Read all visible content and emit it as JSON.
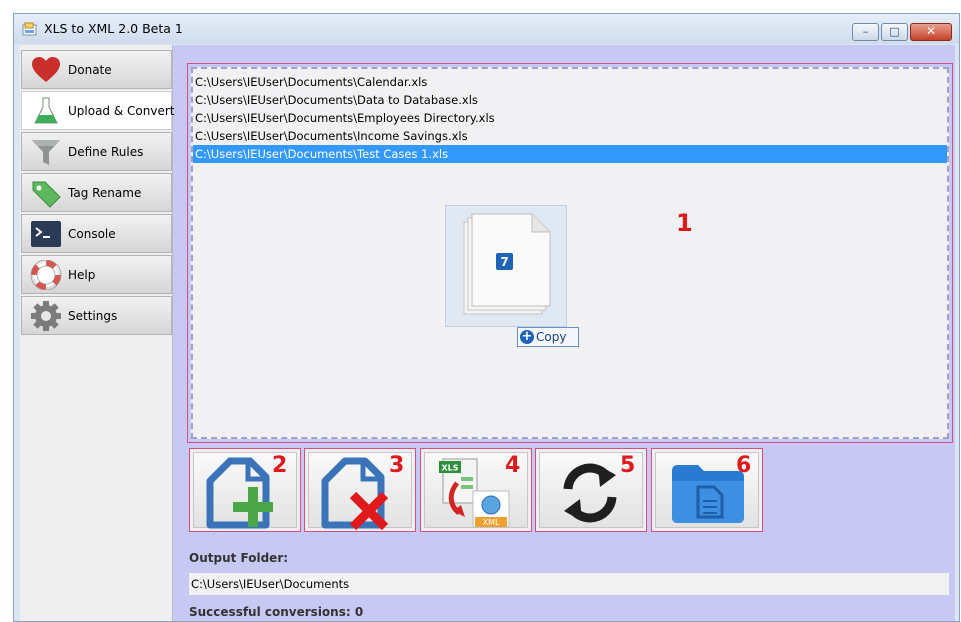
{
  "window": {
    "title": "XLS to XML 2.0 Beta 1",
    "controls": {
      "minimize": "–",
      "maximize": "□",
      "close": "✕"
    }
  },
  "sidebar": {
    "items": [
      {
        "label": "Donate",
        "icon": "heart-icon",
        "active": false
      },
      {
        "label": "Upload & Convert",
        "icon": "flask-icon",
        "active": true
      },
      {
        "label": "Define Rules",
        "icon": "funnel-icon",
        "active": false
      },
      {
        "label": "Tag Rename",
        "icon": "tag-icon",
        "active": false
      },
      {
        "label": "Console",
        "icon": "terminal-icon",
        "active": false
      },
      {
        "label": "Help",
        "icon": "lifebuoy-icon",
        "active": false
      },
      {
        "label": "Settings",
        "icon": "gear-icon",
        "active": false
      }
    ]
  },
  "files": [
    "C:\\Users\\IEUser\\Documents\\Calendar.xls",
    "C:\\Users\\IEUser\\Documents\\Data to Database.xls",
    "C:\\Users\\IEUser\\Documents\\Employees Directory.xls",
    "C:\\Users\\IEUser\\Documents\\Income Savings.xls",
    "C:\\Users\\IEUser\\Documents\\Test Cases 1.xls"
  ],
  "selected_index": 4,
  "drag": {
    "count": "7",
    "action": "Copy"
  },
  "annotations": {
    "drop_area": "1",
    "add": "2",
    "remove": "3",
    "convert": "4",
    "refresh": "5",
    "open_folder": "6"
  },
  "toolbar": {
    "buttons": [
      {
        "icon": "add-file-icon",
        "number": "2"
      },
      {
        "icon": "remove-file-icon",
        "number": "3"
      },
      {
        "icon": "xls-to-xml-icon",
        "number": "4"
      },
      {
        "icon": "refresh-icon",
        "number": "5"
      },
      {
        "icon": "folder-icon",
        "number": "6"
      }
    ],
    "xls_badge": "XLS",
    "xml_badge": "XML"
  },
  "output": {
    "label": "Output Folder:",
    "path": "C:\\Users\\IEUser\\Documents",
    "status": "Successful conversions:  0"
  },
  "colors": {
    "accent": "#3399ff",
    "annotation": "#e0191c",
    "background": "#c8c8f4"
  }
}
